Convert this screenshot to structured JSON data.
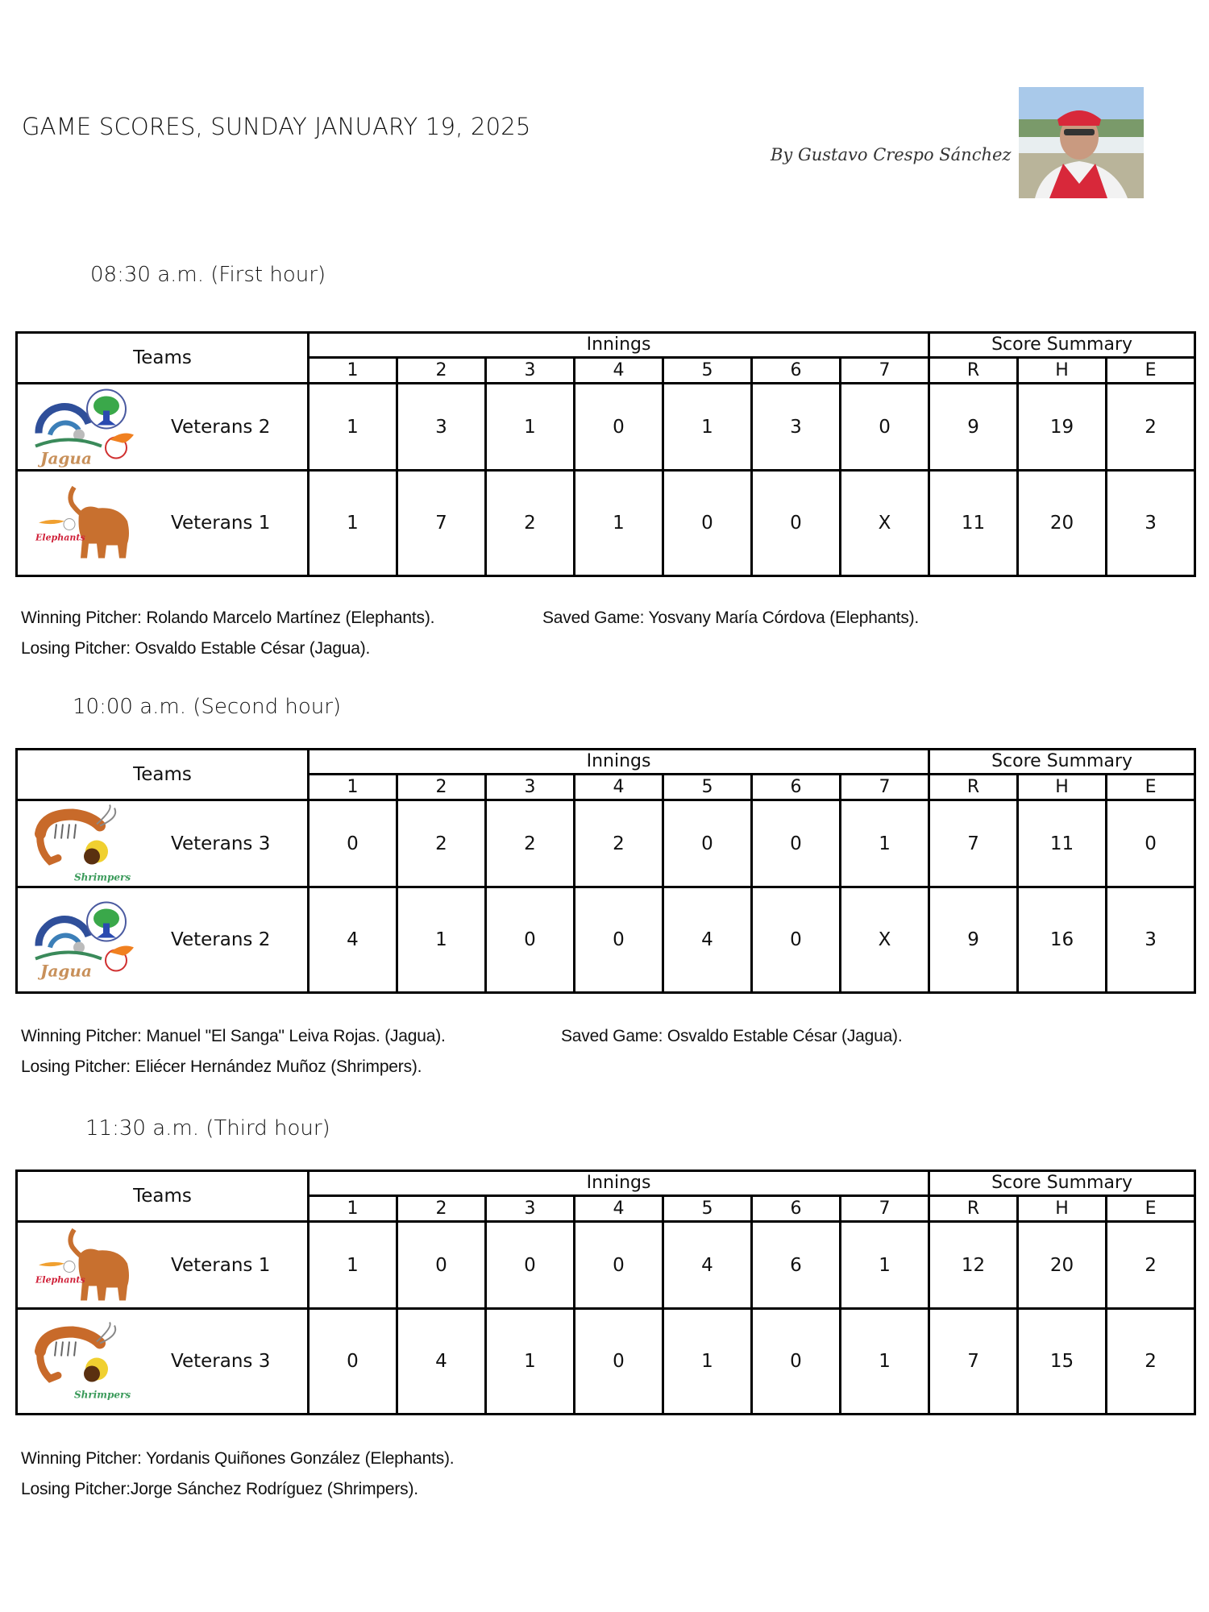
{
  "header": {
    "title": "GAME SCORES, SUNDAY JANUARY 19, 2025",
    "byline": "By Gustavo Crespo Sánchez",
    "photo_icon": "author-photo"
  },
  "columns": {
    "teams": "Teams",
    "innings_group": "Innings",
    "summary_group": "Score Summary",
    "innings": [
      "1",
      "2",
      "3",
      "4",
      "5",
      "6",
      "7"
    ],
    "summary": [
      "R",
      "H",
      "E"
    ]
  },
  "games": [
    {
      "time": "08:30 a.m. (First hour)",
      "rows": [
        {
          "team": "Veterans 2",
          "logo": "jagua-logo",
          "innings": [
            "1",
            "3",
            "1",
            "0",
            "1",
            "3",
            "0"
          ],
          "R": "9",
          "H": "19",
          "E": "2"
        },
        {
          "team": "Veterans 1",
          "logo": "elephants-logo",
          "innings": [
            "1",
            "7",
            "2",
            "1",
            "0",
            "0",
            "X"
          ],
          "R": "11",
          "H": "20",
          "E": "3"
        }
      ],
      "winning": "Winning Pitcher: Rolando Marcelo Martínez (Elephants).",
      "saved": "Saved Game: Yosvany María Córdova (Elephants).",
      "losing": "Losing Pitcher: Osvaldo Estable César (Jagua)."
    },
    {
      "time": "10:00 a.m. (Second hour)",
      "rows": [
        {
          "team": "Veterans 3",
          "logo": "shrimpers-logo",
          "innings": [
            "0",
            "2",
            "2",
            "2",
            "0",
            "0",
            "1"
          ],
          "R": "7",
          "H": "11",
          "E": "0"
        },
        {
          "team": "Veterans 2",
          "logo": "jagua-logo",
          "innings": [
            "4",
            "1",
            "0",
            "0",
            "4",
            "0",
            "X"
          ],
          "R": "9",
          "H": "16",
          "E": "3"
        }
      ],
      "winning": "Winning Pitcher: Manuel \"El Sanga\" Leiva Rojas. (Jagua).",
      "saved": "Saved Game: Osvaldo Estable César (Jagua).",
      "losing": "Losing Pitcher: Eliécer Hernández Muñoz (Shrimpers)."
    },
    {
      "time": "11:30 a.m. (Third hour)",
      "rows": [
        {
          "team": "Veterans 1",
          "logo": "elephants-logo",
          "innings": [
            "1",
            "0",
            "0",
            "0",
            "4",
            "6",
            "1"
          ],
          "R": "12",
          "H": "20",
          "E": "2"
        },
        {
          "team": "Veterans 3",
          "logo": "shrimpers-logo",
          "innings": [
            "0",
            "4",
            "1",
            "0",
            "1",
            "0",
            "1"
          ],
          "R": "7",
          "H": "15",
          "E": "2"
        }
      ],
      "winning": "Winning Pitcher: Yordanis Quiñones González (Elephants).",
      "losing": "Losing Pitcher:Jorge Sánchez Rodríguez (Shrimpers)."
    }
  ],
  "colors": {
    "elephant": "#c8702f",
    "jagua_blue": "#2f4f9a",
    "jagua_green": "#3aa84a",
    "shrimp": "#c86a2a",
    "elephants_text": "#d0223a",
    "shrimpers_text": "#3a9a5a",
    "cap_red": "#d8283a"
  }
}
